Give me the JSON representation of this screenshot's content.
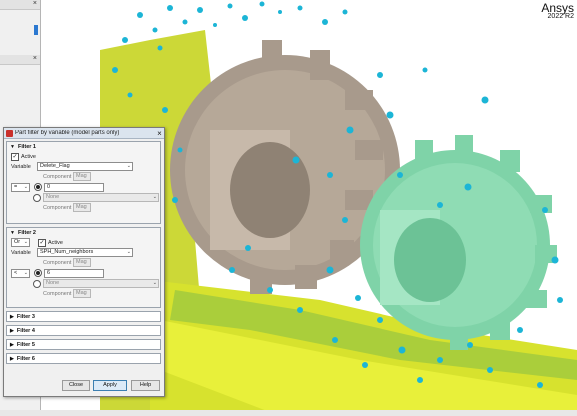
{
  "brand": {
    "name": "Ansys",
    "version": "2022 R2"
  },
  "side_panel": {
    "close_glyph": "×"
  },
  "dialog": {
    "title": "Part filter by variable (model parts only)",
    "close_glyph": "×",
    "filters": [
      {
        "label": "Filter 1",
        "active_label": "Active",
        "active_checked": true,
        "variable_label": "Variable",
        "variable_value": "Delete_Flag",
        "component1_label": "Component",
        "component1_value": "Mag",
        "operator_value": "=",
        "value_input": "0",
        "alt_value": "None",
        "component2_label": "Component",
        "component2_value": "Mag"
      },
      {
        "label": "Filter 2",
        "logic_value": "Or",
        "active_label": "Active",
        "active_checked": true,
        "variable_label": "Variable",
        "variable_value": "SPH_Num_neighbors",
        "component1_label": "Component",
        "component1_value": "Mag",
        "operator_value": "<",
        "value_input": "6",
        "alt_value": "None",
        "component2_label": "Component",
        "component2_value": "Mag"
      }
    ],
    "collapsed_filters": [
      "Filter 3",
      "Filter 4",
      "Filter 5",
      "Filter 6"
    ],
    "buttons": {
      "close": "Close",
      "apply": "Apply",
      "help": "Help"
    }
  },
  "colors": {
    "gear_left": "#a89a8c",
    "gear_right": "#7fd3a8",
    "fluid_yellow": "#d6e02a",
    "particles": "#1cb5d6"
  },
  "icons": [
    "app-icon",
    "close-icon",
    "checkbox-checked-icon",
    "dropdown-arrow-icon",
    "radio-icon",
    "expand-arrow-icon"
  ]
}
